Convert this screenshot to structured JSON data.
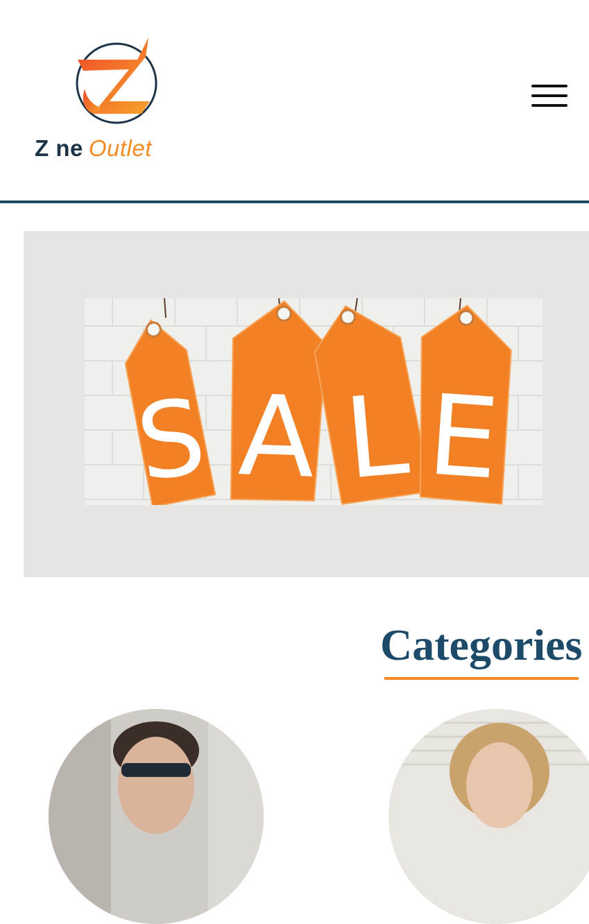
{
  "header": {
    "logo": {
      "word1": "Z ne",
      "word2": "Outlet",
      "colors": {
        "primary": "#1d3347",
        "accent": "#f38b24",
        "mark_gradient_start": "#f04a2a",
        "mark_gradient_end": "#f7a12b"
      }
    },
    "menu_icon": "hamburger-icon",
    "rule_color": "#1d4a69"
  },
  "banner": {
    "image": "sale-tags",
    "tag_letters": [
      "S",
      "A",
      "L",
      "E"
    ],
    "tag_color": "#f28125",
    "background": "#e6e5e3"
  },
  "categories": {
    "title": "Categories",
    "title_color": "#1d4a69",
    "underline_color": "#f38b24",
    "items": [
      {
        "image": "man-with-sunglasses"
      },
      {
        "image": "blonde-woman"
      }
    ]
  }
}
